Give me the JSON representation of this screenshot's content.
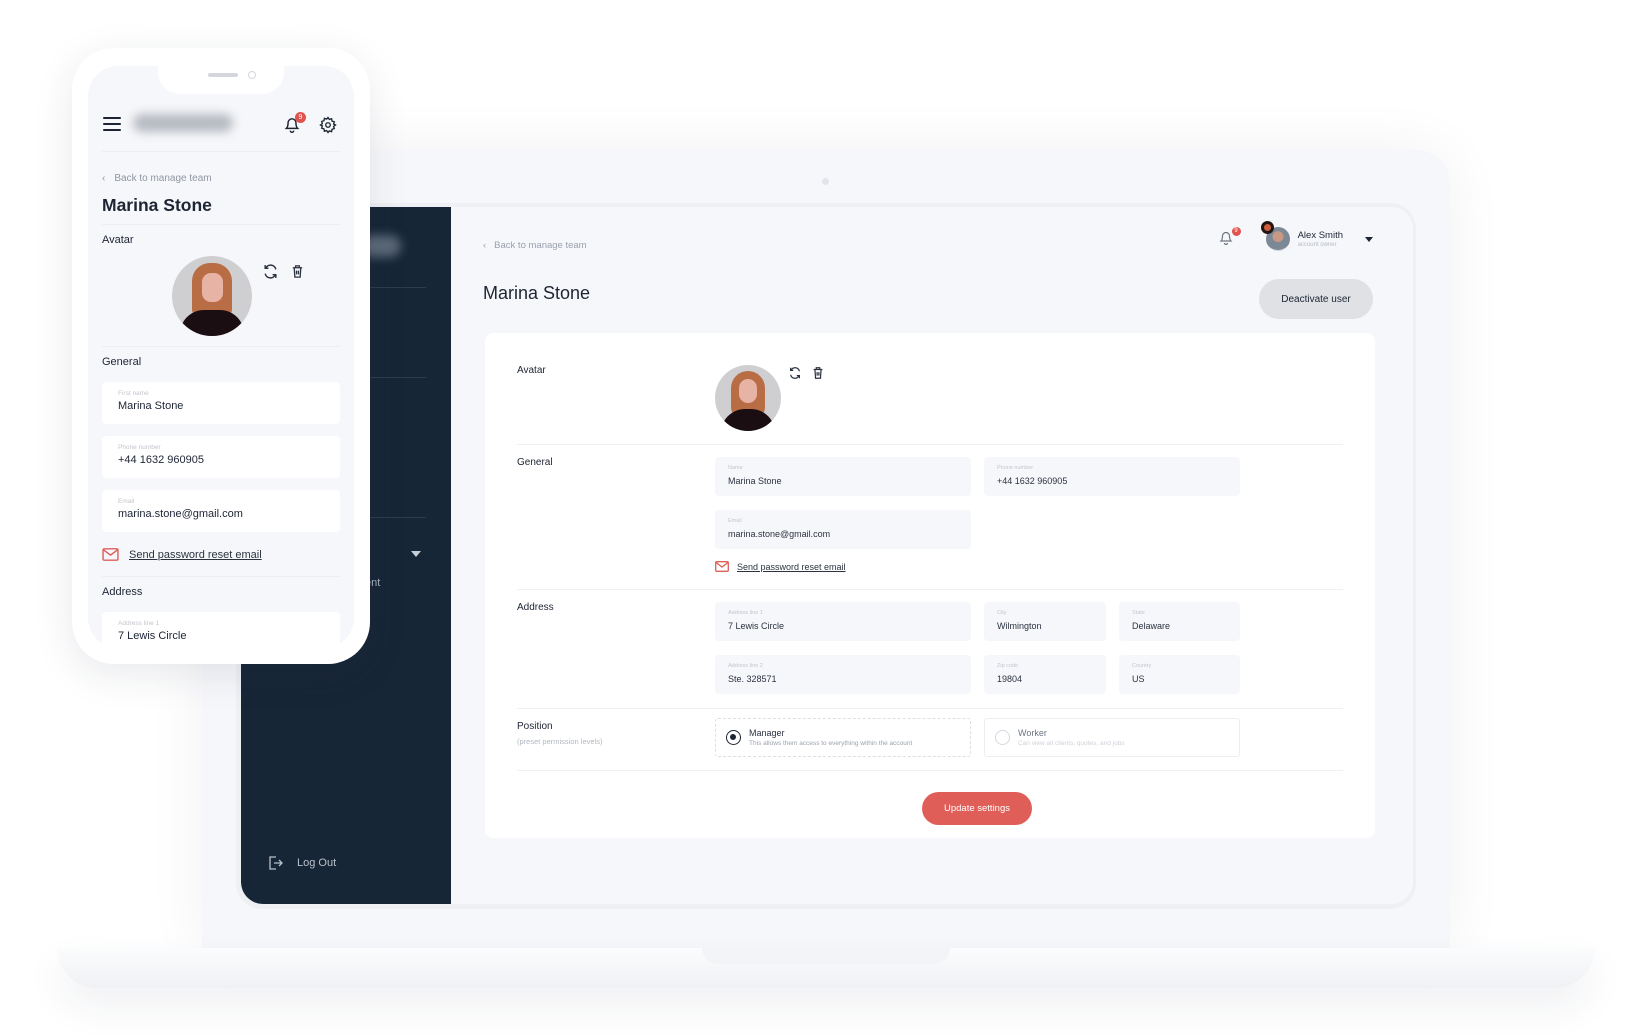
{
  "desktop": {
    "sidebar": {
      "nav_fragment": "ent",
      "logout_label": "Log Out"
    },
    "header": {
      "back_link": "Back to manage team",
      "notification_count": "9",
      "user": {
        "name": "Alex Smith",
        "role": "account owner"
      }
    },
    "page_title": "Marina Stone",
    "deactivate_label": "Deactivate user",
    "sections": {
      "avatar": "Avatar",
      "general": "General",
      "address": "Address",
      "position": "Position",
      "position_sub": "(preset permission levels)"
    },
    "general_fields": {
      "name": {
        "label": "Name",
        "value": "Marina Stone"
      },
      "phone": {
        "label": "Phone number",
        "value": "+44 1632 960905"
      },
      "email": {
        "label": "Email",
        "value": "marina.stone@gmail.com"
      }
    },
    "reset_link": "Send password reset email",
    "address_fields": {
      "line1": {
        "label": "Address line 1",
        "value": "7 Lewis Circle"
      },
      "city": {
        "label": "City",
        "value": "Wilmington"
      },
      "state": {
        "label": "State",
        "value": "Delaware"
      },
      "line2": {
        "label": "Address line 2",
        "value": "Ste. 328571"
      },
      "zip": {
        "label": "Zip code",
        "value": "19804"
      },
      "country": {
        "label": "Country",
        "value": "US"
      }
    },
    "positions": [
      {
        "title": "Manager",
        "desc": "This allows them access to everything within the account",
        "selected": true
      },
      {
        "title": "Worker",
        "desc": "Can view all clients, quotes, and jobs",
        "selected": false
      }
    ],
    "update_label": "Update settings"
  },
  "mobile": {
    "notification_count": "9",
    "back_link": "Back to manage team",
    "page_title": "Marina Stone",
    "sections": {
      "avatar": "Avatar",
      "general": "General",
      "address": "Address"
    },
    "fields": {
      "first_name": {
        "label": "First name",
        "value": "Marina Stone"
      },
      "phone": {
        "label": "Phone number",
        "value": "+44 1632 960905"
      },
      "email": {
        "label": "Email",
        "value": "marina.stone@gmail.com"
      },
      "address1": {
        "label": "Address line 1",
        "value": "7 Lewis Circle"
      }
    },
    "reset_link": "Send password reset email"
  },
  "colors": {
    "sidebar": "#172637",
    "accent": "#df5e58",
    "badge": "#e0534f",
    "background": "#f6f7fa"
  }
}
